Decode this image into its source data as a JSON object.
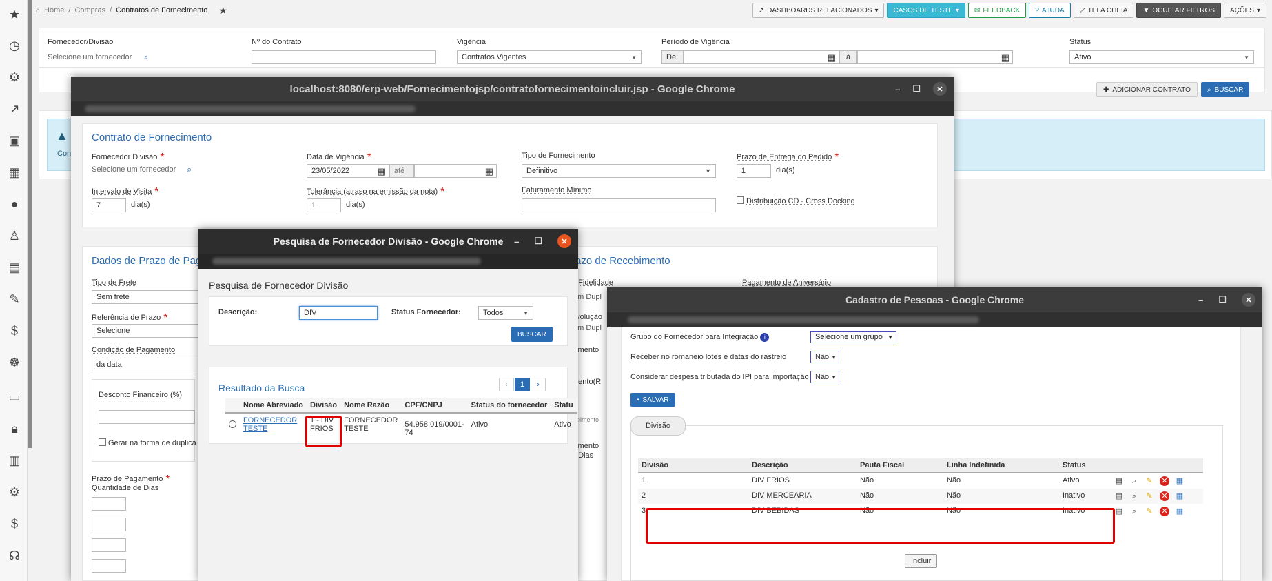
{
  "breadcrumb": {
    "home": "Home",
    "sep": "/",
    "level1": "Compras",
    "current": "Contratos de Fornecimento"
  },
  "toolbar": {
    "dashboards": "DASHBOARDS RELACIONADOS",
    "test_cases": "CASOS DE TESTE",
    "feedback": "FEEDBACK",
    "help": "AJUDA",
    "fullscreen": "TELA CHEIA",
    "hide_filters": "OCULTAR FILTROS",
    "actions": "AÇÕES"
  },
  "filters": {
    "supplier_label": "Fornecedor/Divisão",
    "supplier_placeholder": "Selecione um fornecedor",
    "contract_label": "Nº do Contrato",
    "validity_label": "Vigência",
    "validity_value": "Contratos Vigentes",
    "period_label": "Período de Vigência",
    "period_from": "De:",
    "period_to": "à",
    "status_label": "Status",
    "status_value": "Ativo"
  },
  "actions": {
    "add": "ADICIONAR CONTRATO",
    "search": "BUSCAR"
  },
  "alert": {
    "text": "Con"
  },
  "window1": {
    "title": "localhost:8080/erp-web/Fornecimentojsp/contratofornecimentoincluir.jsp - Google Chrome",
    "section1_title": "Contrato de Fornecimento",
    "supplier_label": "Fornecedor Divisão",
    "supplier_placeholder": "Selecione um fornecedor",
    "validity_label": "Data de Vigência",
    "validity_from": "23/05/2022",
    "validity_until": "até",
    "supply_type_label": "Tipo de Fornecimento",
    "supply_type_value": "Definitivo",
    "delivery_label": "Prazo de Entrega do Pedido",
    "delivery_value": "1",
    "days": "dia(s)",
    "visit_label": "Intervalo de Visita",
    "visit_value": "7",
    "tolerance_label": "Tolerância (atraso na emissão da nota)",
    "tolerance_value": "1",
    "min_billing_label": "Faturamento Mínimo",
    "cross_docking": "Distribuição CD - Cross Docking",
    "section2_title": "Dados de Prazo de Paga",
    "section3_title": "razo de Recebimento",
    "freight_label": "Tipo de Frete",
    "freight_value": "Sem frete",
    "ref_label": "Referência de Prazo",
    "ref_value": "Selecione",
    "payment_cond_label": "Condição de Pagamento",
    "payment_cond_value": "da data",
    "discount_label": "Desconto Financeiro (%)",
    "generate_label": "Gerar na forma de duplica",
    "payment_term_label": "Prazo de Pagamento",
    "qty_days_label": "Quantidade de Dias",
    "fidelity_label": "e Fidelidade",
    "anniversary_label": "Pagamento de Aniversário",
    "dup1": "em Dupl",
    "dup2": "em Dupl",
    "devolucao": "evolução",
    "bimento": "bimento",
    "pagamento_r": "mento(R",
    "ebimento": "ebimento",
    "bimento2": "bimento",
    "e_dias": "e Dias"
  },
  "dialog2": {
    "title": "Pesquisa de Fornecedor Divisão - Google Chrome",
    "heading": "Pesquisa de Fornecedor Divisão",
    "desc_label": "Descrição:",
    "desc_value": "DIV",
    "status_label": "Status Fornecedor:",
    "status_value": "Todos",
    "search_btn": "BUSCAR",
    "result_title": "Resultado da Busca",
    "page": "1",
    "columns": [
      "Nome Abreviado",
      "Divisão",
      "Nome Razão",
      "CPF/CNPJ",
      "Status do fornecedor",
      "Statu"
    ],
    "rows": [
      {
        "name": "FORNECEDOR TESTE",
        "division": "1 - DIV FRIOS",
        "razao": "FORNECEDOR TESTE",
        "cnpj": "54.958.019/0001-74",
        "status": "Ativo",
        "status2": "Ativo"
      }
    ]
  },
  "dialog3": {
    "title": "Cadastro de Pessoas - Google Chrome",
    "group_label": "Grupo do Fornecedor para Integração",
    "group_value": "Selecione um grupo",
    "romaneio_label": "Receber no romaneio lotes e datas do rastreio",
    "romaneio_value": "Não",
    "ipi_label": "Considerar despesa tributada do IPI para importação",
    "ipi_value": "Não",
    "save_btn": "SALVAR",
    "tab": "Divisão",
    "columns": [
      "Divisão",
      "Descrição",
      "Pauta Fiscal",
      "Linha Indefinida",
      "Status"
    ],
    "rows": [
      {
        "div": "1",
        "desc": "DIV FRIOS",
        "pauta": "Não",
        "linha": "Não",
        "status": "Ativo"
      },
      {
        "div": "2",
        "desc": "DIV MERCEARIA",
        "pauta": "Não",
        "linha": "Não",
        "status": "Inativo"
      },
      {
        "div": "3",
        "desc": "DIV BEBIDAS",
        "pauta": "Não",
        "linha": "Não",
        "status": "Inativo"
      }
    ],
    "include_btn": "Incluir"
  },
  "colors": {
    "accent": "#2a6db5",
    "highlight": "#e00000",
    "titlebar": "#3a3a3a"
  }
}
